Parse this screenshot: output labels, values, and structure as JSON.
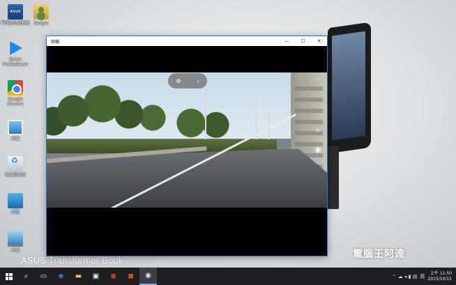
{
  "desktop": {
    "icons": [
      {
        "label": "ASUS",
        "caption": "華碩精明管理員"
      },
      {
        "label": "",
        "caption": "Borges"
      },
      {
        "label": "",
        "caption": "Boom Mediaplayer"
      },
      {
        "label": "",
        "caption": "Google Chrome"
      },
      {
        "label": "",
        "caption": "本機"
      },
      {
        "label": "",
        "caption": "資源回收筒"
      },
      {
        "label": "",
        "caption": "網路"
      },
      {
        "label": "",
        "caption": "本機"
      }
    ],
    "brand": "ASUS Transformer Book",
    "watermark": "電腦王阿達"
  },
  "window": {
    "title": "相機",
    "minimize": "—",
    "maximize": "☐",
    "close": "✕",
    "controls": {
      "more": "···",
      "pill_icon": "⚙",
      "pill_arrow": "›",
      "video_icon": "▭",
      "photo_icon": "◉"
    }
  },
  "taskbar": {
    "search_icon": "⌕",
    "task_view_icon": "▭",
    "edge_icon": "e",
    "explorer_icon": "▬",
    "store_icon": "▣",
    "app1_icon": "◼",
    "app2_icon": "◼",
    "camera_icon": "◉",
    "tray_icons": "⌃ ☁ ◂ ▮ ▤",
    "ime": "英",
    "time": "上午 11:50",
    "date": "2015/10/15"
  }
}
